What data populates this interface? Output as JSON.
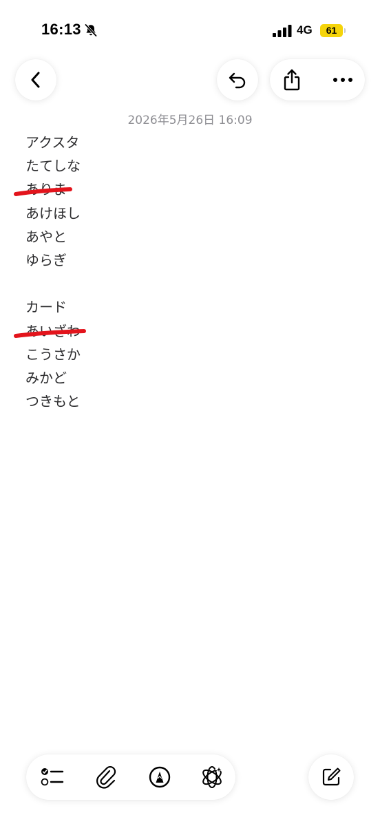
{
  "status_bar": {
    "time": "16:13",
    "network": "4G",
    "battery": "61",
    "icons": [
      "bell-slash-icon",
      "signal-icon"
    ]
  },
  "toolbar": {
    "icons": [
      "chevron-left-icon",
      "undo-icon",
      "share-icon",
      "ellipsis-icon"
    ]
  },
  "note": {
    "date": "2026年5月26日 16:09",
    "lines": [
      {
        "text": "アクスタ",
        "struck": false
      },
      {
        "text": "たてしな",
        "struck": false
      },
      {
        "text": "ありま",
        "struck": true
      },
      {
        "text": "あけほし",
        "struck": false
      },
      {
        "text": "あやと",
        "struck": false
      },
      {
        "text": "ゆらぎ",
        "struck": false
      },
      {
        "text": "",
        "struck": false
      },
      {
        "text": "カード",
        "struck": false
      },
      {
        "text": "あいざわ",
        "struck": true
      },
      {
        "text": "こうさか",
        "struck": false
      },
      {
        "text": "みかど",
        "struck": false
      },
      {
        "text": "つきもと",
        "struck": false
      }
    ],
    "strike_color": "#e3141c"
  },
  "bottom_toolbar": {
    "icons": [
      "checklist-icon",
      "paperclip-icon",
      "markup-pen-icon",
      "apple-intelligence-icon",
      "compose-icon"
    ]
  }
}
